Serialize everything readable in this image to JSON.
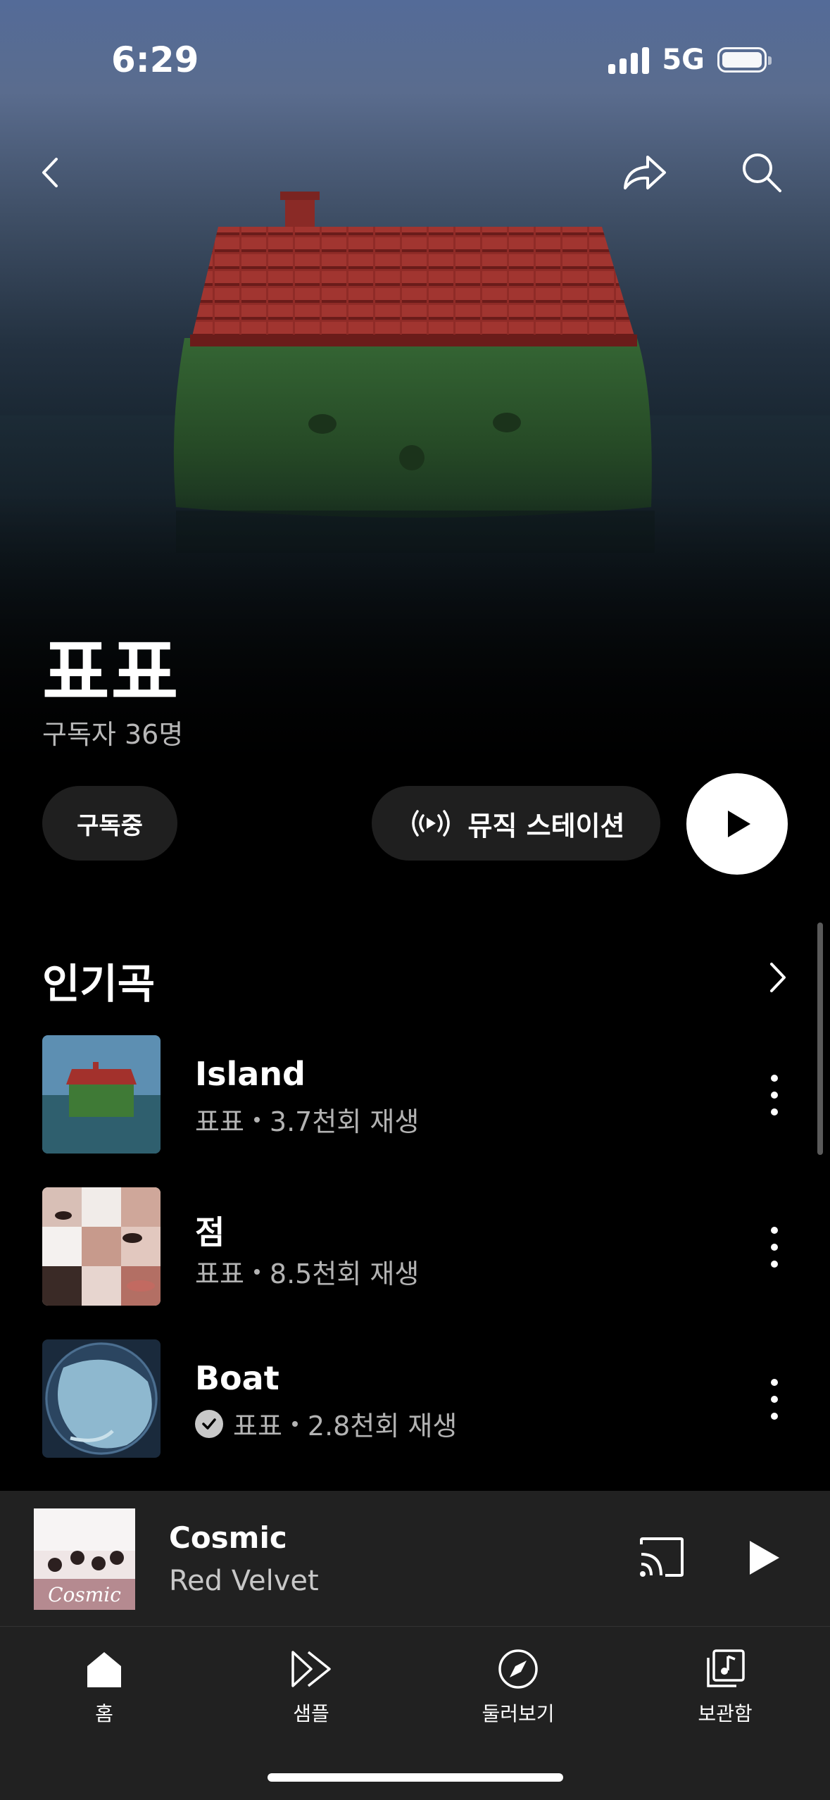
{
  "status": {
    "time": "6:29",
    "network": "5G"
  },
  "artist": {
    "name": "표표",
    "subscribers": "구독자 36명"
  },
  "actions": {
    "subscribe_label": "구독중",
    "station_label": "뮤직 스테이션"
  },
  "popular": {
    "title": "인기곡",
    "songs": [
      {
        "title": "Island",
        "artist": "표표",
        "plays": "3.7천회 재생",
        "verified": false
      },
      {
        "title": "점",
        "artist": "표표",
        "plays": "8.5천회 재생",
        "verified": false
      },
      {
        "title": "Boat",
        "artist": "표표",
        "plays": "2.8천회 재생",
        "verified": true
      }
    ]
  },
  "now_playing": {
    "title": "Cosmic",
    "artist": "Red Velvet",
    "art_text": "Cosmic"
  },
  "nav": [
    {
      "label": "홈",
      "icon": "home-icon",
      "active": true
    },
    {
      "label": "샘플",
      "icon": "samples-icon",
      "active": false
    },
    {
      "label": "둘러보기",
      "icon": "explore-icon",
      "active": false
    },
    {
      "label": "보관함",
      "icon": "library-icon",
      "active": false
    }
  ],
  "colors": {
    "background": "#000000",
    "surface": "#212121",
    "pill": "#1f1f1f",
    "roof": "#8e2a26",
    "grass": "#2f5a2e"
  }
}
